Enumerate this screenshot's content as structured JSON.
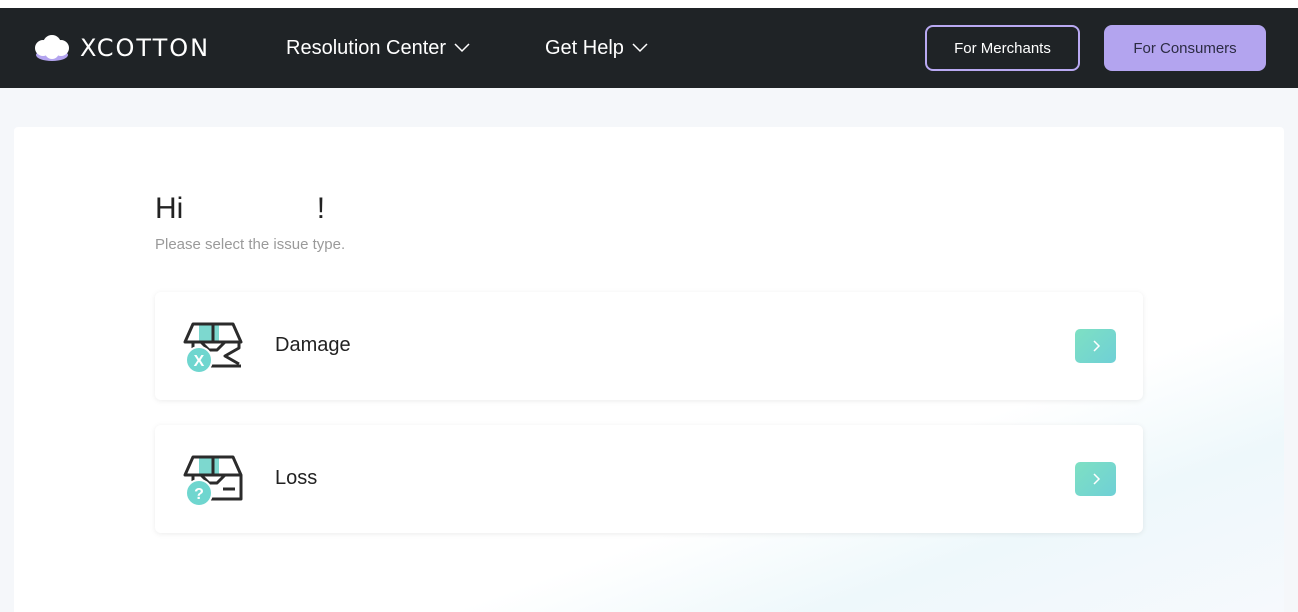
{
  "header": {
    "brand": "XCOTTON",
    "nav": [
      {
        "label": "Resolution Center",
        "icon": "chevron-down-icon"
      },
      {
        "label": "Get Help",
        "icon": "chevron-down-icon"
      }
    ],
    "merchants_label": "For Merchants",
    "consumers_label": "For Consumers"
  },
  "main": {
    "greeting": "Hi                !",
    "subtitle": "Please select the issue type.",
    "issues": [
      {
        "label": "Damage",
        "icon": "damaged-box-icon",
        "badge": "X"
      },
      {
        "label": "Loss",
        "icon": "lost-box-icon",
        "badge": "?"
      }
    ]
  },
  "colors": {
    "navbar": "#1f2326",
    "accent_purple": "#b3a4ef",
    "accent_teal": "#6fd6cf"
  }
}
